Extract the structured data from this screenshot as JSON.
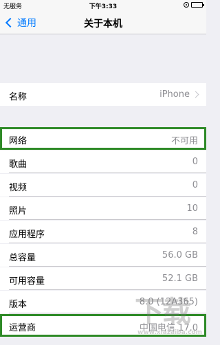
{
  "status_bar": {
    "carrier": "无服务",
    "time": "下午3:33"
  },
  "nav": {
    "back_label": "通用",
    "title": "关于本机"
  },
  "rows": [
    {
      "label": "名称",
      "value": "iPhone"
    },
    {
      "label": "网络",
      "value": "不可用"
    },
    {
      "label": "歌曲",
      "value": "0"
    },
    {
      "label": "视频",
      "value": "0"
    },
    {
      "label": "照片",
      "value": "10"
    },
    {
      "label": "应用程序",
      "value": "8"
    },
    {
      "label": "总容量",
      "value": "56.0 GB"
    },
    {
      "label": "可用容量",
      "value": "52.1 GB"
    },
    {
      "label": "版本",
      "value": "8.0 (12A365)"
    },
    {
      "label": "运营商",
      "value": "中国电信 17.0"
    }
  ],
  "watermark": {
    "text": "下载",
    "sub": "www.xiazaiba.com"
  },
  "colors": {
    "accent": "#007aff",
    "highlight": "#2e8a27",
    "background": "#efeff4"
  },
  "icons": {
    "status_right": [
      "lock-rotation-icon",
      "battery-icon"
    ],
    "back": "chevron-left-icon",
    "disclosure": "chevron-right-icon"
  }
}
